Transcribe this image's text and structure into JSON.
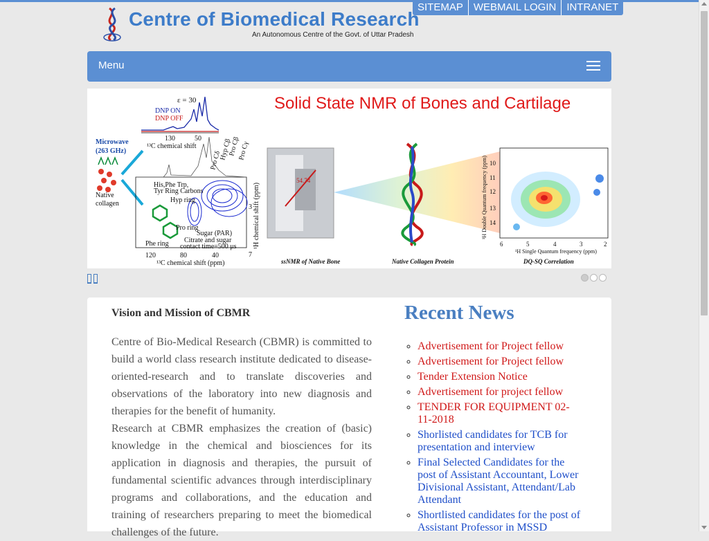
{
  "header": {
    "logo_title": "Centre of Biomedical Research",
    "logo_subtitle": "An Autonomous Centre of the Govt. of Uttar Pradesh",
    "top_links": [
      "SITEMAP",
      "WEBMAIL LOGIN",
      "INTRANET"
    ]
  },
  "nav": {
    "menu_label": "Menu"
  },
  "banner": {
    "title": "Solid State NMR of Bones and Cartilage",
    "labels": {
      "epsilon": "ε = 30",
      "dnp_on": "DNP ON",
      "dnp_off": "DNP OFF",
      "c_shift_top": "¹³C chemical shift",
      "tick_130": "130",
      "tick_50": "50",
      "microwave": "Microwave",
      "ghz": "(263 GHz)",
      "native": "Native",
      "collagen": "collagen",
      "his_phe": "His,Phe Trp,",
      "tyr_ring": "Tyr Ring Carbons",
      "hyp_ring": "Hyp ring",
      "pro_ring": "Pro ring",
      "phe_ring": "Phe ring",
      "sugar": "Sugar (PAR)",
      "citrate": "Citrate and sugar",
      "contact": "contact time=500 μs",
      "pro_cd": "Pro Cδ",
      "hyp_cb": "Hyp Cβ",
      "pro_cb": "Pro Cβ",
      "pro_cg": "Pro Cγ",
      "tick_120": "120",
      "tick_80": "80",
      "tick_40": "40",
      "c_shift_bottom": "¹³C chemical shift (ppm)",
      "h_shift": "¹H chemical shift (ppm)",
      "tick_3": "3",
      "tick_7": "7",
      "angle": "54.74",
      "caption_bone": "ssNMR of Native Bone",
      "caption_collagen": "Native Collagen Protein",
      "caption_dq": "DQ-SQ Correlation",
      "dq_axis": "¹H Double Quantum frequency (ppm)",
      "sq_axis": "¹H Single Quantum frequency (ppm)",
      "dq_10": "10",
      "dq_11": "11",
      "dq_12": "12",
      "dq_13": "13",
      "dq_14": "14",
      "sq_6": "6",
      "sq_5": "5",
      "sq_4": "4",
      "sq_3": "3",
      "sq_2": "2"
    }
  },
  "slider": {
    "dot_count": 3,
    "active_dot": 0
  },
  "vision": {
    "title": "Vision and Mission of CBMR",
    "paragraph1": "Centre of Bio-Medical Research (CBMR) is committed to build a world class research institute dedicated to disease-oriented-research and to translate discoveries and observations of the laboratory into new diagnosis and therapies for the benefit of humanity.",
    "paragraph2": "Research at CBMR emphasizes the creation of (basic) knowledge in the chemical and biosciences for its application in diagnosis and therapies, the pursuit of fundamental scientific advances through interdisciplinary programs and collaborations, and the education and training of researchers preparing to meet the biomedical challenges of the future."
  },
  "news": {
    "title": "Recent News",
    "items": [
      {
        "text": "Advertisement for Project fellow",
        "color": "#d01919"
      },
      {
        "text": "Advertisement for Project fellow",
        "color": "#d01919"
      },
      {
        "text": "Tender Extension Notice",
        "color": "#d01919"
      },
      {
        "text": "Advertisement for project fellow",
        "color": "#d01919"
      },
      {
        "text": "TENDER FOR EQUIPMENT 02-11-2018",
        "color": "#d01919"
      },
      {
        "text": "Shorlisted candidates for TCB for presentation and interview",
        "color": "#1f4fc9"
      },
      {
        "text": "Final Selected Candidates for the post of Assistant Accountant, Lower Divisional Assistant, Attendant/Lab Attendant",
        "color": "#1f4fc9"
      },
      {
        "text": "Shortlisted candidates for the post of Assistant Professor in MSSD",
        "color": "#1f4fc9"
      }
    ]
  },
  "colors": {
    "brand_blue": "#5b8fd3",
    "title_blue": "#3d7cc9",
    "news_red": "#d01919",
    "news_blue": "#1f4fc9"
  }
}
